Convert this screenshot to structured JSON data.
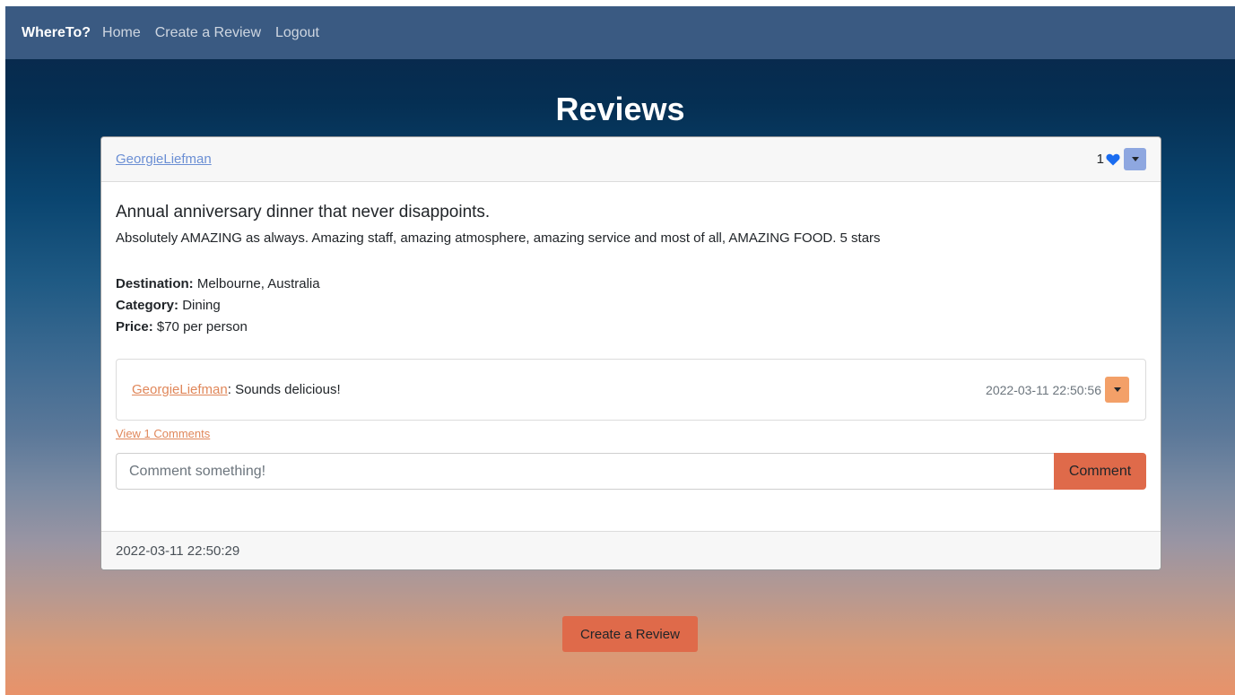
{
  "navbar": {
    "brand": "WhereTo?",
    "links": [
      "Home",
      "Create a Review",
      "Logout"
    ]
  },
  "page": {
    "title": "Reviews"
  },
  "review": {
    "author": "GeorgieLiefman",
    "like_count": "1",
    "title": "Annual anniversary dinner that never disappoints.",
    "body": "Absolutely AMAZING as always. Amazing staff, amazing atmosphere, amazing service and most of all, AMAZING FOOD. 5 stars",
    "destination_label": "Destination:",
    "destination": "Melbourne, Australia",
    "category_label": "Category:",
    "category": "Dining",
    "price_label": "Price:",
    "price": "$70 per person",
    "timestamp": "2022-03-11 22:50:29"
  },
  "comments": {
    "items": [
      {
        "author": "GeorgieLiefman",
        "separator": ":",
        "text": " Sounds delicious!",
        "timestamp": "2022-03-11 22:50:56"
      }
    ],
    "view_link": "View 1 Comments",
    "input_placeholder": "Comment something!",
    "submit_label": "Comment"
  },
  "actions": {
    "create_review": "Create a Review"
  },
  "icons": {
    "like": "heart-icon",
    "review_menu": "caret-down-icon",
    "comment_menu": "caret-down-icon"
  },
  "colors": {
    "accent": "#df6a4a",
    "link_blue": "#6b8fd4",
    "link_orange": "#e0875a",
    "heart": "#1a6cf0"
  }
}
